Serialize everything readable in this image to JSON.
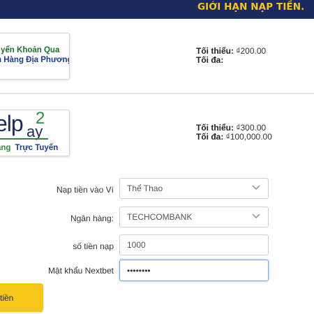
{
  "header": {
    "title": "GIỚI HẠN NẠP TIỀN."
  },
  "methods": [
    {
      "logo_line1": "yển Khoản Qua",
      "logo_line2": "n Hàng Địa Phương",
      "min_label": "Tối thiểu:",
      "min_value": "₫200.00",
      "max_label": "Tối đa:",
      "max_value": ""
    },
    {
      "logo_main": "elp",
      "logo_sup": "2",
      "logo_pay": "ay",
      "logo_tag1": "ang",
      "logo_tag2": "Trực Tuyến",
      "min_label": "Tối thiểu:",
      "min_value": "₫300.00",
      "max_label": "Tối đa:",
      "max_value": "₫100,000.00"
    }
  ],
  "form": {
    "wallet_label": "Nạp tiền vào Ví",
    "wallet_value": "Thể Thao",
    "bank_label": "Ngân hàng:",
    "bank_value": "TECHCOMBANK",
    "amount_label": "số tiền nạp",
    "amount_value": "1000",
    "password_label": "Mật khẩu Nextbet",
    "password_value": "••••••••",
    "submit_label": "tiền"
  },
  "colors": {
    "header_bg": "#1a2a5c",
    "header_text": "#f5c518",
    "button_bg": "#f5c518"
  }
}
